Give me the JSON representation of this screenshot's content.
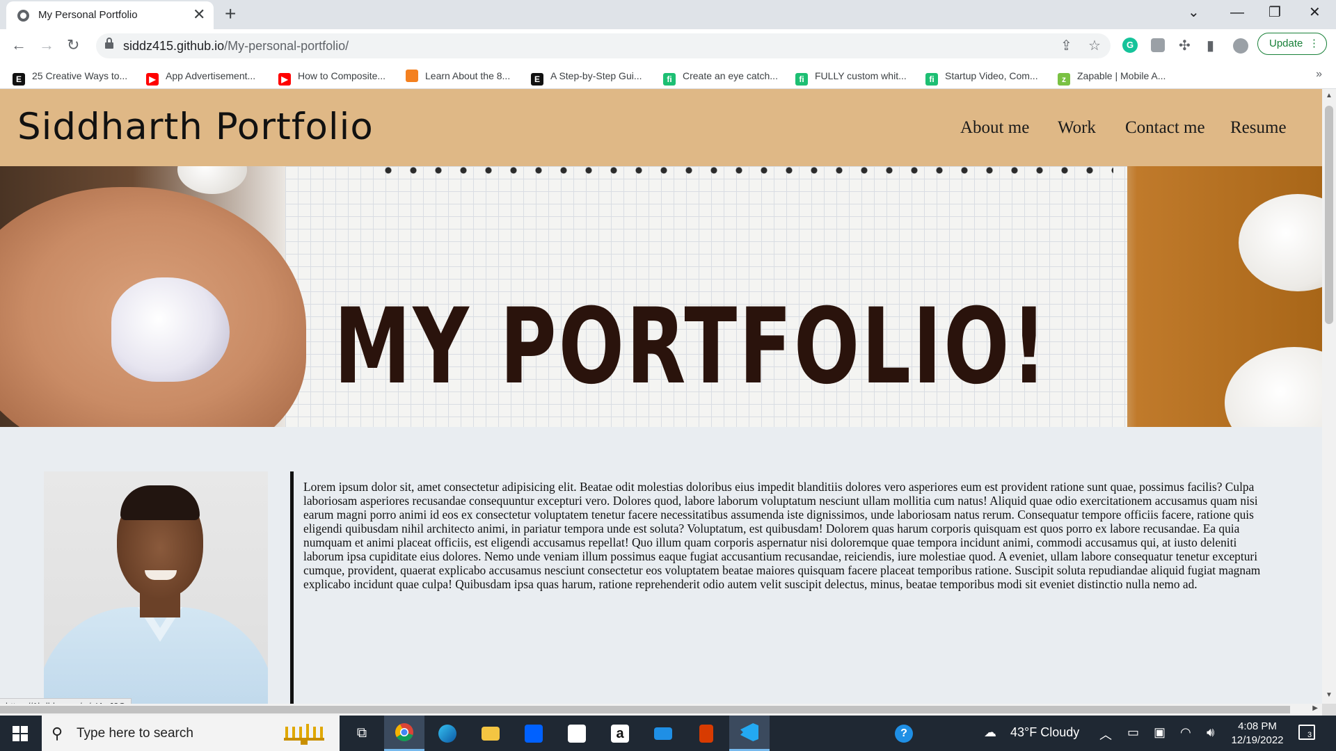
{
  "browser": {
    "tab_title": "My Personal Portfolio",
    "tab_close": "✕",
    "new_tab": "+",
    "url_host": "siddz415.github.io",
    "url_path": "/My-personal-portfolio/",
    "update_label": "Update",
    "grammarly_label": "G",
    "bookmarks": [
      {
        "label": "25 Creative Ways to...",
        "icon": "E",
        "color": "#111111"
      },
      {
        "label": "App Advertisement...",
        "icon": "▶",
        "color": "#ff0000"
      },
      {
        "label": "How to Composite...",
        "icon": "▶",
        "color": "#ff0000"
      },
      {
        "label": "Learn About the 8...",
        "icon": "",
        "color": "#f4801f"
      },
      {
        "label": "A Step-by-Step Gui...",
        "icon": "E",
        "color": "#111111"
      },
      {
        "label": "Create an eye catch...",
        "icon": "fi",
        "color": "#1dbf73"
      },
      {
        "label": "FULLY custom whit...",
        "icon": "fi",
        "color": "#1dbf73"
      },
      {
        "label": "Startup Video, Com...",
        "icon": "fi",
        "color": "#1dbf73"
      },
      {
        "label": "Zapable | Mobile A...",
        "icon": "z",
        "color": "#7ac143"
      }
    ],
    "bookmarks_more": "»",
    "status_url": "https://1bdbbrv.ms/w/s!ApJ2G"
  },
  "site": {
    "title": "Siddharth Portfolio",
    "nav": [
      "About me",
      "Work",
      "Contact me",
      "Resume"
    ],
    "hero_text": "MY PORTFOLIO!",
    "bio": "Lorem ipsum dolor sit, amet consectetur adipisicing elit. Beatae odit molestias doloribus eius impedit blanditiis dolores vero asperiores eum est provident ratione sunt quae, possimus facilis? Culpa laboriosam asperiores recusandae consequuntur excepturi vero. Dolores quod, labore laborum voluptatum nesciunt ullam mollitia cum natus! Aliquid quae odio exercitationem accusamus quam nisi earum magni porro animi id eos ex consectetur voluptatem tenetur facere necessitatibus assumenda iste dignissimos, unde laboriosam natus rerum. Consequatur tempore officiis facere, ratione quis eligendi quibusdam nihil architecto animi, in pariatur tempora unde est soluta? Voluptatum, est quibusdam! Dolorem quas harum corporis quisquam est quos porro ex labore recusandae. Ea quia numquam et animi placeat officiis, est eligendi accusamus repellat! Quo illum quam corporis aspernatur nisi doloremque quae tempora incidunt animi, commodi accusamus qui, at iusto deleniti laborum ipsa cupiditate eius dolores. Nemo unde veniam illum possimus eaque fugiat accusantium recusandae, reiciendis, iure molestiae quod. A eveniet, ullam labore consequatur tenetur excepturi cumque, provident, quaerat explicabo accusamus nesciunt consectetur eos voluptatem beatae maiores quisquam facere placeat temporibus ratione. Suscipit soluta repudiandae aliquid fugiat magnam explicabo incidunt quae culpa! Quibusdam ipsa quas harum, ratione reprehenderit odio autem velit suscipit delectus, minus, beatae temporibus modi sit eveniet distinctio nulla nemo ad."
  },
  "colors": {
    "header_bg": "#dfb886",
    "page_bg": "#e9edf1",
    "update_green": "#188038",
    "taskbar_bg": "#1f2833"
  },
  "taskbar": {
    "search_placeholder": "Type here to search",
    "apps": [
      "task-view",
      "chrome",
      "edge",
      "file-explorer",
      "dropbox",
      "microsoft-store",
      "amazon",
      "mail",
      "office",
      "vscode",
      "help"
    ],
    "weather": "43°F  Cloudy",
    "time": "4:08 PM",
    "date": "12/19/2022",
    "notification_count": "3"
  }
}
